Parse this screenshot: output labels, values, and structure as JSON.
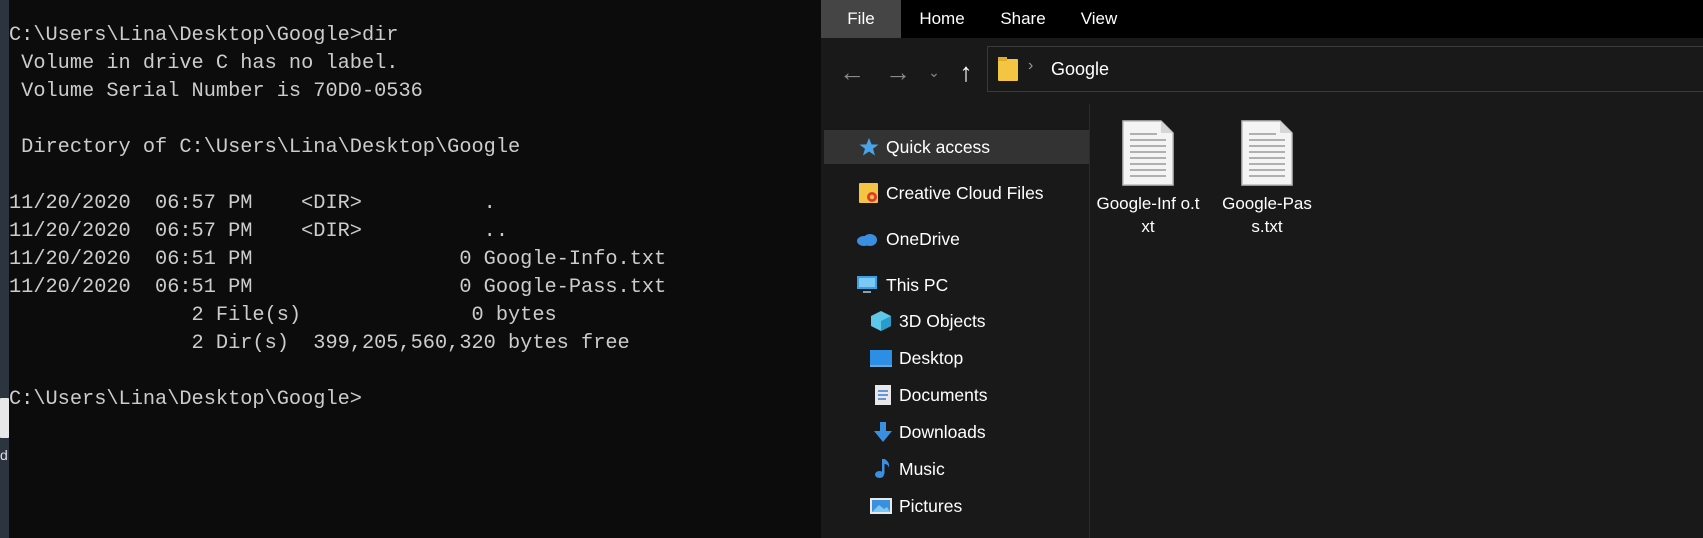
{
  "desktop": {
    "icon_label_fragment": "d"
  },
  "console": {
    "lines": [
      "C:\\Users\\Lina\\Desktop\\Google>dir",
      " Volume in drive C has no label.",
      " Volume Serial Number is 70D0-0536",
      "",
      " Directory of C:\\Users\\Lina\\Desktop\\Google",
      "",
      "11/20/2020  06:57 PM    <DIR>          .",
      "11/20/2020  06:57 PM    <DIR>          ..",
      "11/20/2020  06:51 PM                 0 Google-Info.txt",
      "11/20/2020  06:51 PM                 0 Google-Pass.txt",
      "               2 File(s)              0 bytes",
      "               2 Dir(s)  399,205,560,320 bytes free",
      "",
      "C:\\Users\\Lina\\Desktop\\Google>"
    ]
  },
  "explorer": {
    "ribbon_tabs": [
      "File",
      "Home",
      "Share",
      "View"
    ],
    "nav_icons": [
      "back-arrow-icon",
      "forward-arrow-icon",
      "recent-dropdown-icon",
      "up-arrow-icon"
    ],
    "address": {
      "current_folder": "Google",
      "separator": "›"
    },
    "nav_pane": {
      "quick_access": "Quick access",
      "creative_cloud": "Creative Cloud Files",
      "onedrive": "OneDrive",
      "this_pc": "This PC",
      "objects_3d": "3D Objects",
      "desktop": "Desktop",
      "documents": "Documents",
      "downloads": "Downloads",
      "music": "Music",
      "pictures": "Pictures"
    },
    "files": [
      {
        "name": "Google-Info.txt",
        "display": "Google-Inf o.txt"
      },
      {
        "name": "Google-Pass.txt",
        "display": "Google-Pas s.txt"
      }
    ]
  },
  "colors": {
    "console_bg": "#0c0c0c",
    "console_text": "#cccccc",
    "explorer_bg": "#191919",
    "ribbon_active": "#454545",
    "selected_item": "#333333"
  }
}
